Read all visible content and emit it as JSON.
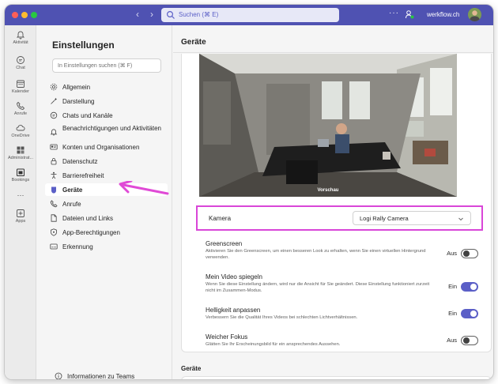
{
  "titlebar": {
    "search_placeholder": "Suchen (⌘ E)",
    "more": "···",
    "org": "werkflow.ch"
  },
  "rail": [
    {
      "label": "Aktivität",
      "icon": "bell-icon"
    },
    {
      "label": "Chat",
      "icon": "chat-icon"
    },
    {
      "label": "Kalender",
      "icon": "calendar-icon"
    },
    {
      "label": "Anrufe",
      "icon": "phone-icon"
    },
    {
      "label": "OneDrive",
      "icon": "cloud-icon"
    },
    {
      "label": "Administrat...",
      "icon": "admin-icon"
    },
    {
      "label": "Bookings",
      "icon": "bookings-icon"
    },
    {
      "label": "···",
      "icon": "more-icon"
    },
    {
      "label": "Apps",
      "icon": "apps-icon"
    }
  ],
  "settings": {
    "title": "Einstellungen",
    "search_placeholder": "In Einstellungen suchen (⌘ F)",
    "items": [
      {
        "label": "Allgemein",
        "icon": "gear-icon"
      },
      {
        "label": "Darstellung",
        "icon": "sparkle-icon"
      },
      {
        "label": "Chats und Kanäle",
        "icon": "chat-icon"
      },
      {
        "label": "Benachrichtigungen und Aktivitäten",
        "icon": "bell-icon"
      },
      {
        "label": "Konten und Organisationen",
        "icon": "id-card-icon"
      },
      {
        "label": "Datenschutz",
        "icon": "lock-icon"
      },
      {
        "label": "Barrierefreiheit",
        "icon": "accessibility-icon"
      },
      {
        "label": "Geräte",
        "icon": "devices-icon"
      },
      {
        "label": "Anrufe",
        "icon": "phone-icon"
      },
      {
        "label": "Dateien und Links",
        "icon": "file-icon"
      },
      {
        "label": "App-Berechtigungen",
        "icon": "shield-icon"
      },
      {
        "label": "Erkennung",
        "icon": "caption-icon"
      }
    ],
    "active_index": 7,
    "footer": "Informationen zu Teams"
  },
  "main": {
    "title": "Geräte",
    "preview_label": "Vorschau",
    "camera_label": "Kamera",
    "camera_value": "Logi Rally Camera",
    "options": [
      {
        "title": "Greenscreen",
        "desc": "Aktivieren Sie den Greenscreen, um einen besseren Look zu erhalten, wenn Sie einen virtuellen Hintergrund verwenden.",
        "state": "Aus",
        "on": false
      },
      {
        "title": "Mein Video spiegeln",
        "desc": "Wenn Sie diese Einstellung ändern, wird nur die Ansicht für Sie geändert. Diese Einstellung funktioniert zurzeit nicht im Zusammen-Modus.",
        "state": "Ein",
        "on": true
      },
      {
        "title": "Helligkeit anpassen",
        "desc": "Verbessern Sie die Qualität Ihres Videos bei schlechten Lichtverhältnissen.",
        "state": "Ein",
        "on": true
      },
      {
        "title": "Weicher Fokus",
        "desc": "Glätten Sie Ihr Erscheinungsbild für ein ansprechendes Aussehen.",
        "state": "Aus",
        "on": false
      }
    ],
    "section2_title": "Geräte"
  },
  "colors": {
    "titlebar": "#4f52b2",
    "accent": "#5b5fc7",
    "highlight": "#d946d8"
  }
}
